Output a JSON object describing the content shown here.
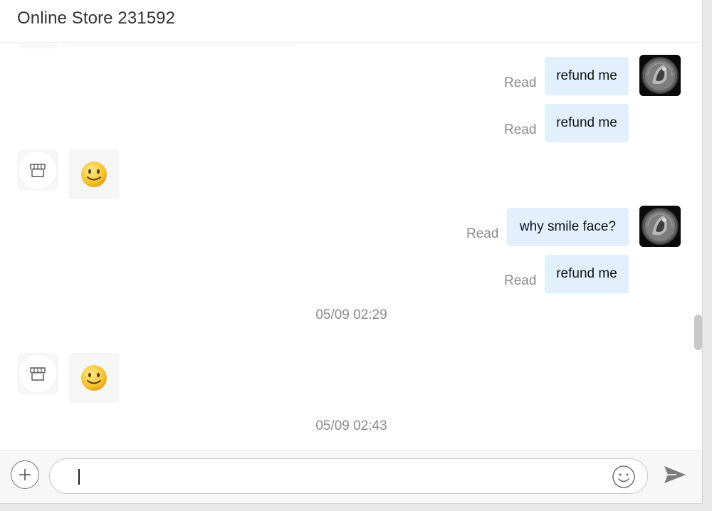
{
  "header": {
    "title": "Online Store 231592"
  },
  "messages": {
    "m1": {
      "text": "refund me",
      "status": "Read"
    },
    "m2": {
      "text": "refund me",
      "status": "Read"
    },
    "m3": {
      "text": "why smile face?",
      "status": "Read"
    },
    "m4": {
      "text": "refund me",
      "status": "Read"
    },
    "incoming_1": {
      "content": "smiley-face-emoji"
    },
    "incoming_2": {
      "content": "smiley-face-emoji"
    },
    "timestamps": [
      "05/09 02:29",
      "05/09 02:43"
    ]
  },
  "composer": {
    "input_value": "",
    "icons": {
      "attach": "plus-icon",
      "emoji": "smiley-icon",
      "send": "send-icon"
    }
  },
  "colors": {
    "outgoing_bubble": "#e2f0fd",
    "incoming_bubble": "#f6f6f6",
    "status_text": "#8a8a8a"
  }
}
